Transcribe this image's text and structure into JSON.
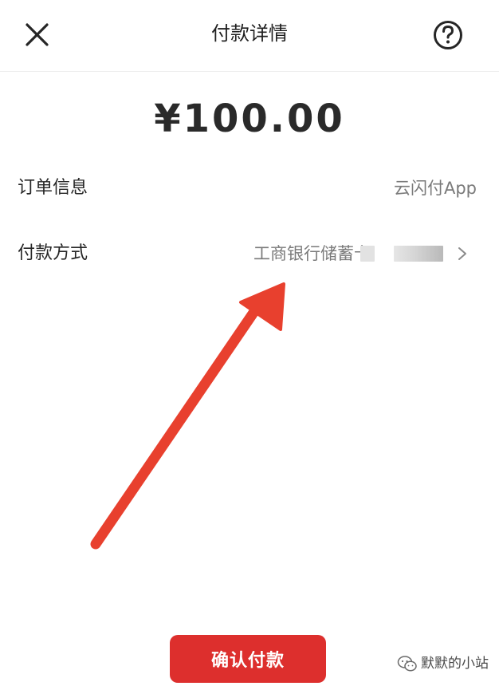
{
  "header": {
    "close_icon": "close-icon",
    "title": "付款详情",
    "help_icon": "help-circle-icon"
  },
  "payment": {
    "amount": "¥100.00"
  },
  "order_info": {
    "label": "订单信息",
    "value": "云闪付App"
  },
  "payment_method": {
    "label": "付款方式",
    "value": "工商银行储蓄卡",
    "chevron_icon": "chevron-right-icon"
  },
  "annotation": {
    "arrow_color": "#e8402e"
  },
  "confirm": {
    "label": "确认付款",
    "color": "#dd2f2d"
  },
  "watermark": {
    "icon": "wechat-icon",
    "text": "默默的小站"
  }
}
